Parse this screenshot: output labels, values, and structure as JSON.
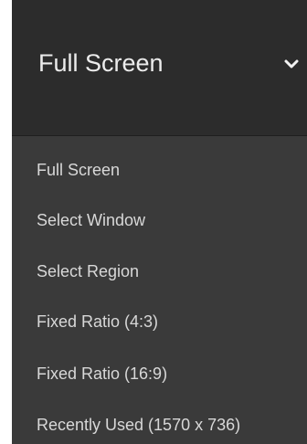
{
  "dropdown": {
    "selected_label": "Full Screen",
    "chevron_icon": "chevron-down-icon",
    "items": [
      {
        "label": "Full Screen"
      },
      {
        "label": "Select Window"
      },
      {
        "label": "Select Region"
      },
      {
        "label": "Fixed Ratio (4:3)"
      },
      {
        "label": "Fixed Ratio (16:9)"
      },
      {
        "label": "Recently Used (1570 x 736)"
      }
    ]
  },
  "colors": {
    "header_bg": "#2c2c2c",
    "menu_bg": "#3a3a3a",
    "text": "#d8d8d8"
  }
}
